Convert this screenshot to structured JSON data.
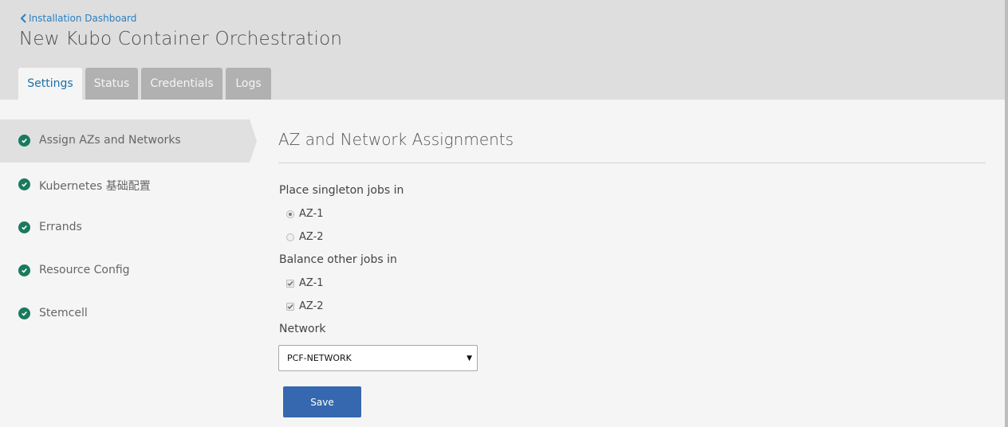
{
  "header": {
    "back_link": "Installation Dashboard",
    "title": "New Kubo Container Orchestration",
    "tabs": [
      {
        "label": "Settings"
      },
      {
        "label": "Status"
      },
      {
        "label": "Credentials"
      },
      {
        "label": "Logs"
      }
    ]
  },
  "sidebar": {
    "items": [
      {
        "label": "Assign AZs and Networks"
      },
      {
        "label": "Kubernetes 基础配置"
      },
      {
        "label": "Errands"
      },
      {
        "label": "Resource Config"
      },
      {
        "label": "Stemcell"
      }
    ]
  },
  "main": {
    "section_title": "AZ and Network Assignments",
    "singleton_label": "Place singleton jobs in",
    "singleton_options": [
      "AZ-1",
      "AZ-2"
    ],
    "singleton_selected": "AZ-1",
    "balance_label": "Balance other jobs in",
    "balance_options": [
      "AZ-1",
      "AZ-2"
    ],
    "balance_checked": [
      "AZ-1",
      "AZ-2"
    ],
    "network_label": "Network",
    "network_value": "PCF-NETWORK",
    "save_label": "Save"
  },
  "colors": {
    "accent": "#2a7fc1",
    "check": "#1a7a5e",
    "save_button": "#3568ae"
  }
}
